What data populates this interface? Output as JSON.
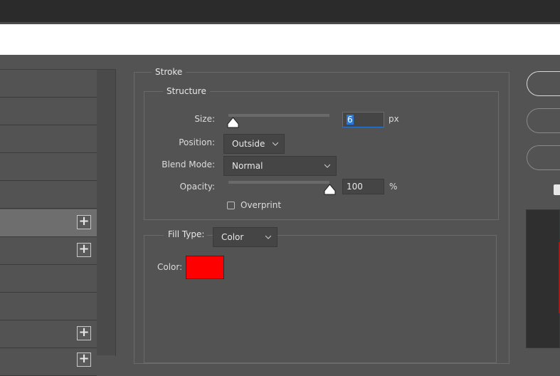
{
  "stroke": {
    "title": "Stroke",
    "structure": {
      "title": "Structure",
      "size": {
        "label": "Size:",
        "value": "6",
        "unit": "px",
        "slider_fraction": 0.05
      },
      "position": {
        "label": "Position:",
        "value": "Outside"
      },
      "blend_mode": {
        "label": "Blend Mode:",
        "value": "Normal"
      },
      "opacity": {
        "label": "Opacity:",
        "value": "100",
        "unit": "%",
        "slider_fraction": 1.0
      },
      "overprint": {
        "label": "Overprint",
        "checked": false
      }
    },
    "fill": {
      "label": "Fill Type:",
      "value": "Color",
      "color_label": "Color:",
      "color": "#ff0000"
    }
  },
  "left_panel": {
    "rows": [
      {
        "selected": false,
        "has_plus": false
      },
      {
        "selected": false,
        "has_plus": false
      },
      {
        "selected": false,
        "has_plus": false
      },
      {
        "selected": false,
        "has_plus": false
      },
      {
        "selected": false,
        "has_plus": false
      },
      {
        "selected": true,
        "has_plus": true
      },
      {
        "selected": false,
        "has_plus": true
      },
      {
        "selected": false,
        "has_plus": false
      },
      {
        "selected": false,
        "has_plus": false
      },
      {
        "selected": false,
        "has_plus": true
      }
    ],
    "plus_icon": "plus-icon"
  },
  "colors": {
    "panel_bg": "#535353",
    "accent": "#2b78d4",
    "stroke_color": "#ff0000"
  }
}
